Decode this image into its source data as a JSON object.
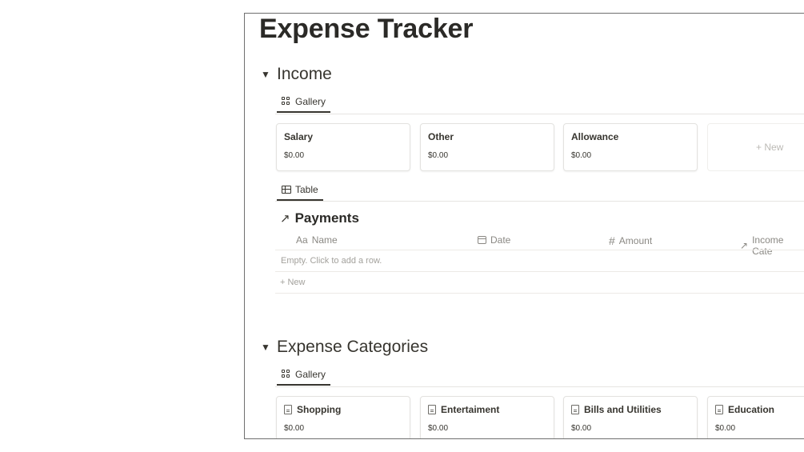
{
  "page": {
    "title": "Expense Tracker"
  },
  "income": {
    "toggle": "▼",
    "title": "Income",
    "gallery_tab": "Gallery",
    "cards": [
      {
        "title": "Salary",
        "value": "$0.00"
      },
      {
        "title": "Other",
        "value": "$0.00"
      },
      {
        "title": "Allowance",
        "value": "$0.00"
      }
    ],
    "new_card_label": "+ New",
    "table_tab": "Table"
  },
  "payments": {
    "arrow": "↗",
    "title": "Payments",
    "columns": [
      {
        "icon": "text-icon",
        "glyph": "Aa",
        "label": "Name"
      },
      {
        "icon": "calendar-icon",
        "glyph": "",
        "label": "Date"
      },
      {
        "icon": "number-icon",
        "glyph": "#",
        "label": "Amount"
      },
      {
        "icon": "relation-icon",
        "glyph": "↗",
        "label": "Income Cate"
      }
    ],
    "empty_text": "Empty. Click to add a row.",
    "new_row_label": "+ New"
  },
  "expenses": {
    "toggle": "▼",
    "title": "Expense Categories",
    "gallery_tab": "Gallery",
    "cards": [
      {
        "title": "Shopping",
        "value": "$0.00"
      },
      {
        "title": "Entertaiment",
        "value": "$0.00"
      },
      {
        "title": "Bills and Utilities",
        "value": "$0.00"
      },
      {
        "title": "Education",
        "value": "$0.00"
      }
    ]
  }
}
